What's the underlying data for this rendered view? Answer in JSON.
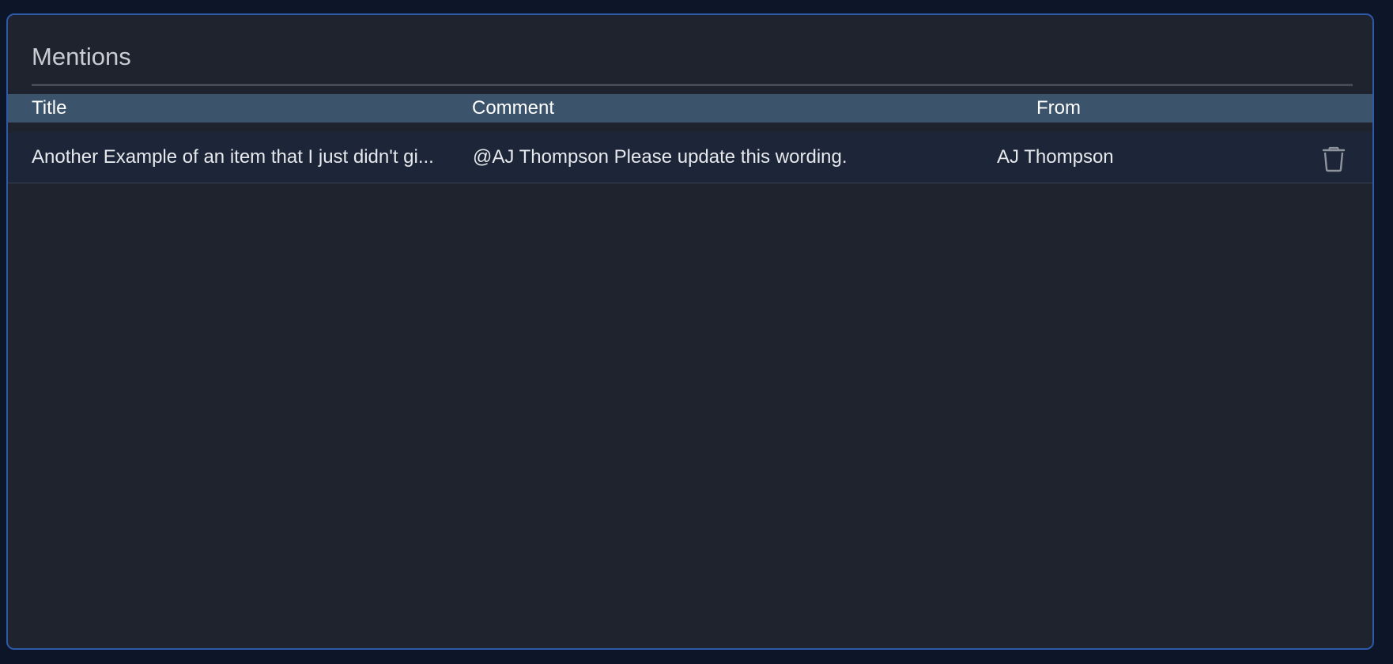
{
  "panel": {
    "title": "Mentions"
  },
  "table": {
    "columns": {
      "title": "Title",
      "comment": "Comment",
      "from": "From"
    },
    "rows": [
      {
        "title": "Another Example of an item that I just didn't gi...",
        "comment": "@AJ Thompson Please update this wording.",
        "from": "AJ Thompson",
        "action_icon": "trash-icon"
      }
    ]
  },
  "colors": {
    "page_background": "#0c1628",
    "panel_background": "#1f232d",
    "panel_border": "#2e59a8",
    "header_background": "#3b546b",
    "row_background": "#1c2638"
  }
}
